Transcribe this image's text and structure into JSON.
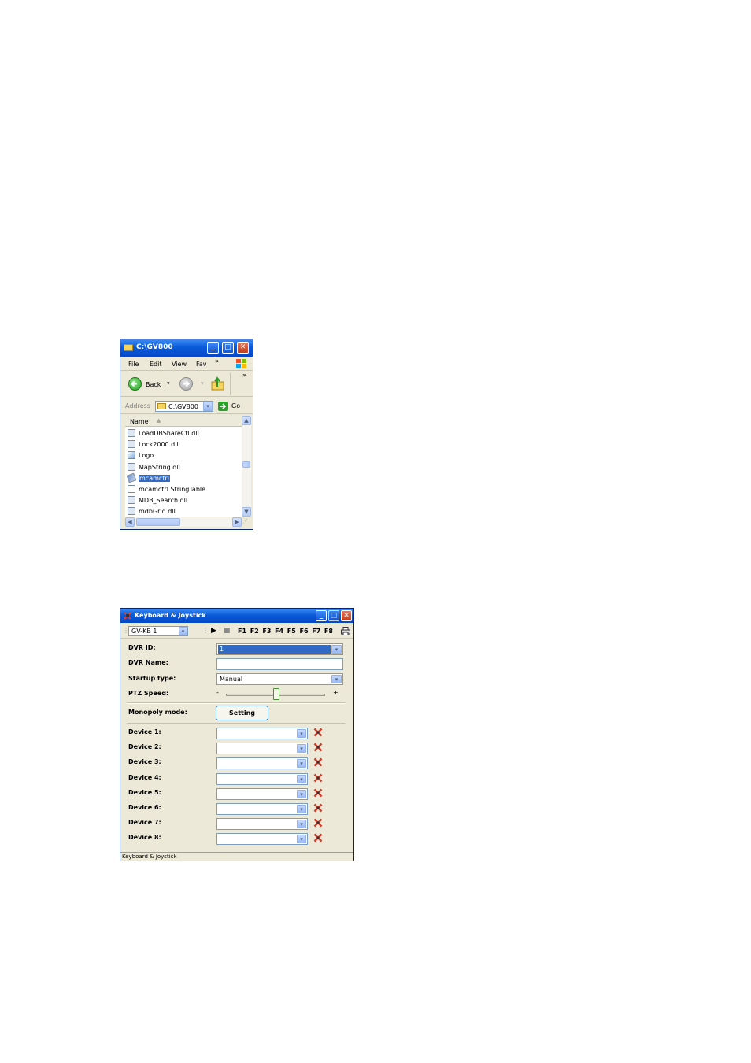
{
  "explorer": {
    "title": "C:\\GV800",
    "menu": [
      "File",
      "Edit",
      "View",
      "Fav"
    ],
    "menu_more": "»",
    "toolbar": {
      "back_label": "Back",
      "more": "»"
    },
    "address": {
      "label": "Address",
      "value": "C:\\GV800",
      "go_label": "Go"
    },
    "list": {
      "column_name": "Name",
      "files": [
        {
          "name": "LoadDBShareCtl.dll",
          "icon": "dll-file-icon",
          "selected": false
        },
        {
          "name": "Lock2000.dll",
          "icon": "dll-file-icon",
          "selected": false
        },
        {
          "name": "Logo",
          "icon": "image-file-icon",
          "selected": false
        },
        {
          "name": "MapString.dll",
          "icon": "dll-file-icon",
          "selected": false
        },
        {
          "name": "mcamctrl",
          "icon": "application-icon",
          "selected": true
        },
        {
          "name": "mcamctrl.StringTable",
          "icon": "text-file-icon",
          "selected": false
        },
        {
          "name": "MDB_Search.dll",
          "icon": "dll-file-icon",
          "selected": false
        },
        {
          "name": "mdbGrid.dll",
          "icon": "dll-file-icon",
          "selected": false
        }
      ]
    }
  },
  "kbj": {
    "title": "Keyboard & Joystick",
    "device_select": "GV-KB 1",
    "fkeys": [
      "F1",
      "F2",
      "F3",
      "F4",
      "F5",
      "F6",
      "F7",
      "F8"
    ],
    "fields": {
      "dvr_id_label": "DVR ID:",
      "dvr_id_value": "1",
      "dvr_name_label": "DVR Name:",
      "dvr_name_value": "",
      "startup_label": "Startup type:",
      "startup_value": "Manual",
      "ptz_label": "PTZ Speed:",
      "ptz_minus": "-",
      "ptz_plus": "+",
      "monopoly_label": "Monopoly mode:",
      "setting_button": "Setting"
    },
    "devices": [
      "Device 1:",
      "Device 2:",
      "Device 3:",
      "Device 4:",
      "Device 5:",
      "Device 6:",
      "Device 7:",
      "Device 8:"
    ],
    "status": "Keyboard & Joystick",
    "colors": {
      "title_bar": "#0a5bd8",
      "selection": "#316ac5",
      "window_bg": "#ece9d8"
    }
  }
}
